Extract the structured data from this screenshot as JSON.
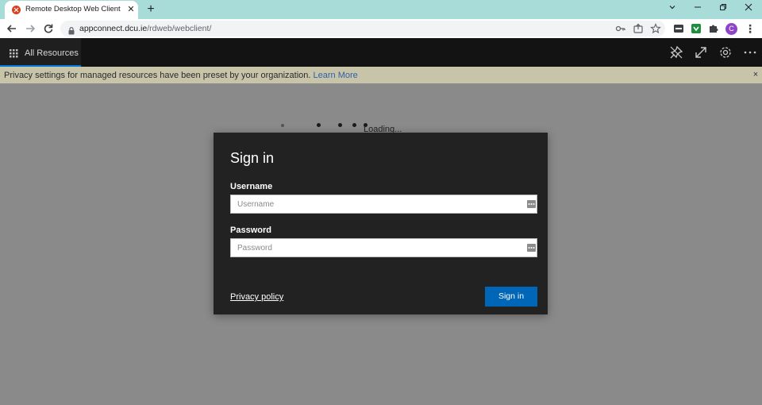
{
  "browser": {
    "tab_title": "Remote Desktop Web Client",
    "tab_close": "✕",
    "new_tab": "+",
    "url_host": "appconnect.dcu.ie",
    "url_path": "/rdweb/webclient/",
    "avatar_letter": "C",
    "icons": [
      "back-arrow-icon",
      "forward-arrow-icon",
      "reload-icon",
      "lock-icon",
      "key-icon",
      "share-icon",
      "star-icon",
      "extension-icon",
      "puzzle-icon",
      "more-vert-icon"
    ]
  },
  "app": {
    "header_tab_label": "All Resources",
    "accent_color": "#0078d4",
    "header_icons": [
      "pin-icon",
      "fullscreen-icon",
      "settings-icon",
      "more-icon"
    ]
  },
  "banner": {
    "text": "Privacy settings for managed resources have been preset by your organization.",
    "link": "Learn More",
    "close": "×"
  },
  "loading": {
    "text": "Loading..."
  },
  "dialog": {
    "title": "Sign in",
    "username_label": "Username",
    "username_placeholder": "Username",
    "username_value": "",
    "password_label": "Password",
    "password_placeholder": "Password",
    "password_value": "",
    "privacy_link": "Privacy policy",
    "signin_button": "Sign in",
    "button_color": "#0067b8"
  }
}
